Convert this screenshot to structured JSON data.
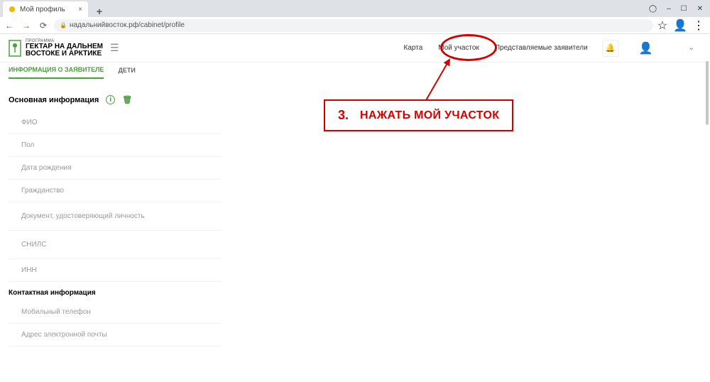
{
  "browser": {
    "tab_title": "Мой профиль",
    "url": "надальнийвосток.рф/cabinet/profile",
    "window_controls": {
      "min": "–",
      "max": "☐",
      "close": "✕"
    },
    "controls": {
      "fullscreen": "◯"
    }
  },
  "logo": {
    "program": "ПРОГРАММА",
    "line1": "ГЕКТАР НА ДАЛЬНЕМ",
    "line2": "ВОСТОКЕ И АРКТИКЕ"
  },
  "nav": {
    "map": "Карта",
    "my_plot": "Мой участок",
    "represented": "Представляемые заявители"
  },
  "subtabs": {
    "applicant_info": "ИНФОРМАЦИЯ О ЗАЯВИТЕЛЕ",
    "children": "ДЕТИ"
  },
  "sections": {
    "main_info": "Основная информация",
    "contact_info": "Контактная информация"
  },
  "fields": {
    "fio": "ФИО",
    "gender": "Пол",
    "dob": "Дата рождения",
    "citizenship": "Гражданство",
    "id_doc": "Документ, удостоверяющий личность",
    "snils": "СНИЛС",
    "inn": "ИНН",
    "phone": "Мобильный телефон",
    "email": "Адрес электронной почты"
  },
  "annotation": {
    "num": "3.",
    "text": "НАЖАТЬ МОЙ УЧАСТОК"
  }
}
